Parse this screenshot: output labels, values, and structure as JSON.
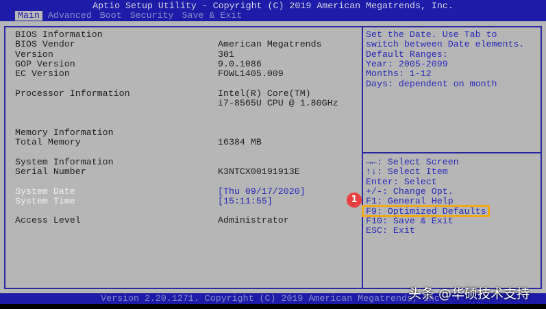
{
  "header": {
    "title": "Aptio Setup Utility - Copyright (C) 2019 American Megatrends, Inc.",
    "tabs": [
      "Main",
      "Advanced",
      "Boot",
      "Security",
      "Save & Exit"
    ],
    "active_tab": "Main"
  },
  "main": {
    "rows": [
      {
        "label": "BIOS Information",
        "value": ""
      },
      {
        "label": "BIOS Vendor",
        "value": "American Megatrends"
      },
      {
        "label": "Version",
        "value": "301"
      },
      {
        "label": "GOP Version",
        "value": "9.0.1086"
      },
      {
        "label": "EC Version",
        "value": "FOWL1405.009"
      },
      {
        "label": "Processor Information",
        "value": "Intel(R) Core(TM)"
      },
      {
        "label": "",
        "value": "i7-8565U CPU @ 1.80GHz"
      },
      {
        "label": "Memory Information",
        "value": ""
      },
      {
        "label": "Total Memory",
        "value": "16384 MB"
      },
      {
        "label": "System Information",
        "value": ""
      },
      {
        "label": "Serial Number",
        "value": "K3NTCX00191913E"
      },
      {
        "label": "System Date",
        "value": "[Thu 09/17/2020]"
      },
      {
        "label": "System Time",
        "value": "[15:11:55]"
      },
      {
        "label": "Access Level",
        "value": "Administrator"
      }
    ]
  },
  "help": {
    "description": [
      "Set the Date. Use Tab to",
      "switch between Date elements.",
      "Default Ranges:",
      "Year: 2005-2099",
      "Months: 1-12",
      "Days: dependent on month"
    ],
    "keys": [
      "→←: Select Screen",
      "↑↓: Select Item",
      "Enter: Select",
      "+/-: Change Opt.",
      "F1: General Help",
      "F9: Optimized Defaults",
      "F10: Save & Exit",
      "ESC: Exit"
    ]
  },
  "footer": {
    "version": "Version 2.20.1271. Copyright (C) 2019 American Megatrends, Inc."
  },
  "annotation": {
    "badge": "1",
    "highlight_color": "#f0a818"
  },
  "watermark": "头条 @华硕技术支持"
}
